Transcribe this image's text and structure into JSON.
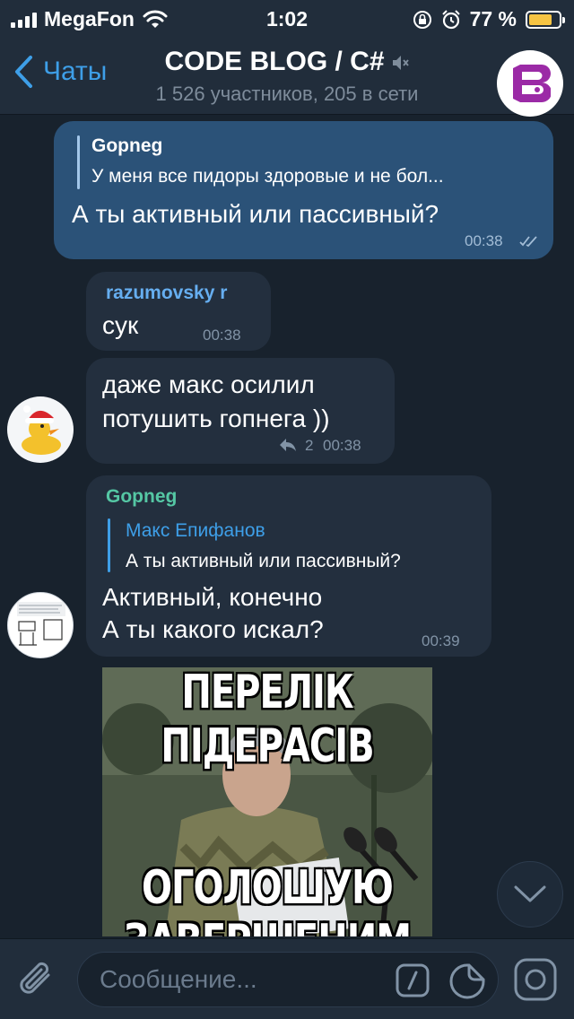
{
  "status_bar": {
    "carrier": "MegaFon",
    "time": "1:02",
    "battery": "77 %",
    "battery_level": 0.77
  },
  "header": {
    "back_label": "Чаты",
    "title": "CODE BLOG / C#",
    "subtitle": "1 526 участников, 205 в сети"
  },
  "messages": [
    {
      "reply_author": "Gopneg",
      "reply_text": "У меня все пидоры здоровые и не бол...",
      "text": "А ты активный или пассивный?",
      "time": "00:38"
    },
    {
      "author": "razumovsky r",
      "text": "сук",
      "time": "00:38"
    },
    {
      "line1": "даже макс осилил",
      "line2": "потушить гопнега ))",
      "replies": "2",
      "time": "00:38"
    },
    {
      "author": "Gopneg",
      "reply_author": "Макс Епифанов",
      "reply_text": "А ты активный или пассивный?",
      "line1": "Активный, конечно",
      "line2": "А ты какого искал?",
      "time": "00:39"
    }
  ],
  "meme": {
    "top": "ПЕРЕЛІК ПІДЕРАСІВ",
    "bottom": "ОГОЛОШУЮ ЗАВЕРШЕНИМ"
  },
  "composer": {
    "placeholder": "Сообщение..."
  },
  "colors": {
    "accent": "#3e9fe8",
    "incoming": "#232f3e",
    "outgoing": "#2b5278",
    "background": "#18222d",
    "razumovsky_name": "#66aef0",
    "gopneg_name": "#55c7a4",
    "reply_name": "#3e9fe8"
  },
  "icons": [
    "back-chevron-icon",
    "mute-icon",
    "read-checks-icon",
    "reply-arrow-icon",
    "attach-icon",
    "bot-command-icon",
    "sticker-icon",
    "camera-icon",
    "chevron-down-icon"
  ]
}
